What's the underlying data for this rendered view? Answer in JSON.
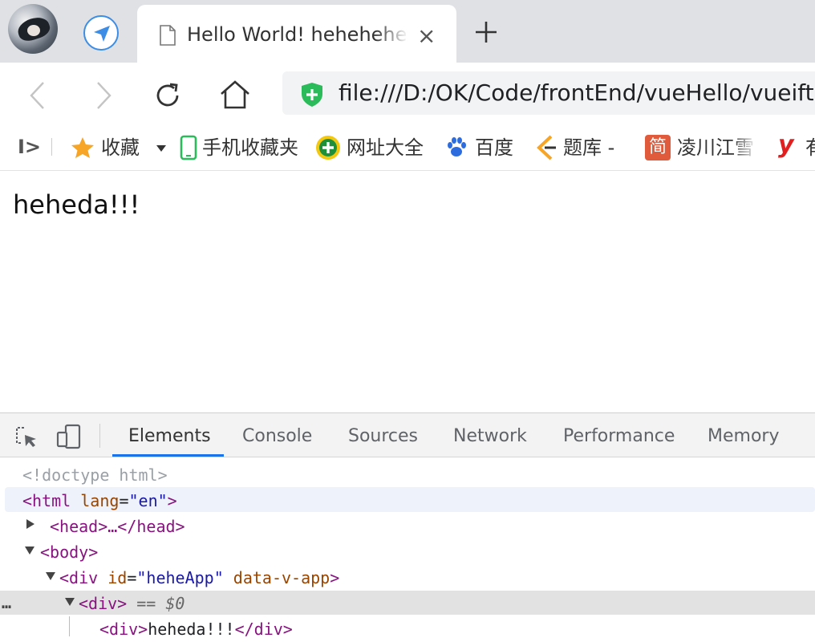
{
  "browser": {
    "tab": {
      "title": "Hello World! hehehehehe",
      "close_glyph": "×",
      "new_tab_glyph": "+"
    },
    "address": {
      "url": "file:///D:/OK/Code/frontEnd/vueHello/vueift"
    },
    "bookmarks": {
      "sidebar_glyph": "I>",
      "items": [
        {
          "label": "收藏",
          "icon": "star-icon"
        },
        {
          "label": "手机收藏夹",
          "icon": "phone-icon"
        },
        {
          "label": "网址大全",
          "icon": "plus-circle-icon"
        },
        {
          "label": "百度",
          "icon": "paw-icon"
        },
        {
          "label": "题库 -",
          "icon": "library-icon"
        },
        {
          "label": "凌川江雪",
          "icon": "jian-icon"
        },
        {
          "label": "有",
          "icon": "y-logo-icon"
        }
      ],
      "jian_glyph": "简",
      "y_glyph": "y"
    }
  },
  "page": {
    "text": "heheda!!!"
  },
  "devtools": {
    "tabs": [
      "Elements",
      "Console",
      "Sources",
      "Network",
      "Performance",
      "Memory"
    ],
    "active_tab": "Elements",
    "dom": {
      "doctype": "<!doctype html>",
      "html_open": "<html",
      "html_attr": "lang",
      "html_val": "\"en\"",
      "html_close": ">",
      "head": "<head>…</head>",
      "body": "<body>",
      "div_open": "<div",
      "div_id_attr": "id",
      "div_id_val": "\"heheApp\"",
      "div_v_attr": "data-v-app",
      "div_close": ">",
      "selected": "<div>",
      "selected_hint": "== $0",
      "inner_open": "<div>",
      "inner_text": "heheda!!!",
      "inner_close": "</div>",
      "ellipsis": "…"
    }
  },
  "colors": {
    "accent": "#1a73e8",
    "tag": "#881280",
    "attr": "#994500",
    "value": "#1a1aa6"
  }
}
